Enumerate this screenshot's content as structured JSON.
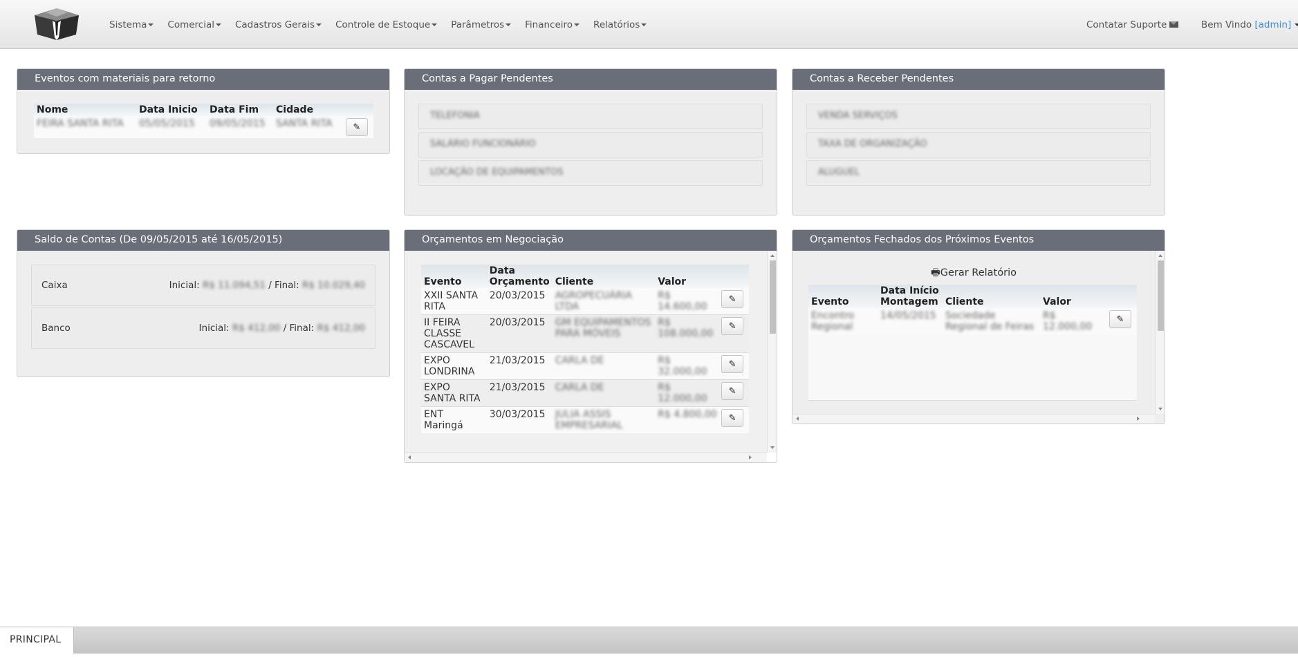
{
  "nav": {
    "menus": [
      "Sistema",
      "Comercial",
      "Cadastros Gerais",
      "Controle de Estoque",
      "Parâmetros",
      "Financeiro",
      "Relatórios"
    ],
    "support_label": "Contatar Suporte",
    "welcome_prefix": "Bem Vindo ",
    "user": "[admin]"
  },
  "eventos_retorno": {
    "title": "Eventos com materiais para retorno",
    "columns": [
      "Nome",
      "Data Inicio",
      "Data Fim",
      "Cidade"
    ],
    "rows": [
      {
        "nome": "FEIRA SANTA RITA",
        "inicio": "05/05/2015",
        "fim": "09/05/2015",
        "cidade": "SANTA RITA"
      }
    ]
  },
  "contas_pagar": {
    "title": "Contas a Pagar Pendentes",
    "items": [
      "TELEFONIA",
      "SALÁRIO FUNCIONÁRIO",
      "LOCAÇÃO DE EQUIPAMENTOS"
    ]
  },
  "contas_receber": {
    "title": "Contas a Receber Pendentes",
    "items": [
      "VENDA SERVIÇOS",
      "TAXA DE ORGANIZAÇÃO",
      "ALUGUEL"
    ]
  },
  "saldo": {
    "title": "Saldo de Contas (De 09/05/2015 até 16/05/2015)",
    "initial_label": "Inicial:",
    "final_label": "/ Final:",
    "accounts": [
      {
        "name": "Caixa",
        "inicial": "R$ 11.094,51",
        "final": "R$ 10.029,40"
      },
      {
        "name": "Banco",
        "inicial": "R$ 412,00",
        "final": "R$ 412,00"
      }
    ]
  },
  "orcamentos_negociacao": {
    "title": "Orçamentos em Negociação",
    "columns": [
      "Evento",
      "Data Orçamento",
      "Cliente",
      "Valor"
    ],
    "rows": [
      {
        "evento": "XXII SANTA RITA",
        "data": "20/03/2015",
        "cliente": "AGROPECUÁRIA LTDA",
        "valor": "R$ 14.600,00"
      },
      {
        "evento": "II FEIRA CLASSE CASCAVEL",
        "data": "20/03/2015",
        "cliente": "GM EQUIPAMENTOS PARA MÓVEIS",
        "valor": "R$ 108.000,00"
      },
      {
        "evento": "EXPO LONDRINA",
        "data": "21/03/2015",
        "cliente": "CARLA DE",
        "valor": "R$ 32.000,00"
      },
      {
        "evento": "EXPO SANTA RITA",
        "data": "21/03/2015",
        "cliente": "CARLA DE",
        "valor": "R$ 12.000,00"
      },
      {
        "evento": "ENT Maringá",
        "data": "30/03/2015",
        "cliente": "JULIA ASSIS EMPRESARIAL",
        "valor": "R$ 4.800,00"
      }
    ]
  },
  "orcamentos_fechados": {
    "title": "Orçamentos Fechados dos Próximos Eventos",
    "report_label": "Gerar Relatório",
    "columns": [
      "Evento",
      "Data Início Montagem",
      "Cliente",
      "Valor"
    ],
    "rows": [
      {
        "evento": "Encontro Regional",
        "data": "14/05/2015",
        "cliente": "Sociedade Regional de Feiras",
        "valor": "R$ 12.000,00"
      }
    ]
  },
  "tabs": {
    "active": "PRINCIPAL"
  }
}
